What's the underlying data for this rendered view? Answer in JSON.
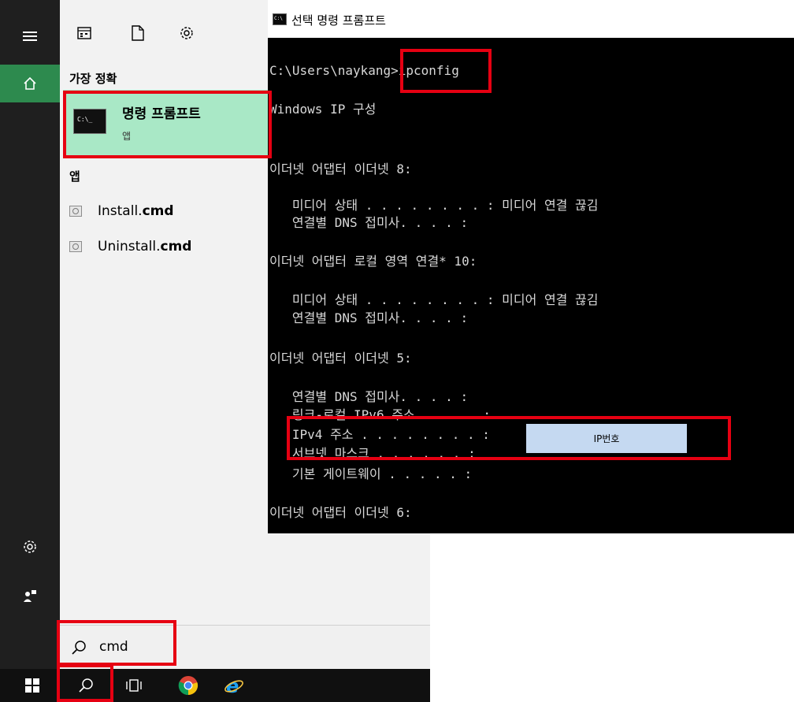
{
  "start_menu": {
    "rail_icons": [
      "hamburger-icon",
      "home-icon",
      "gear-icon",
      "user-feedback-icon"
    ],
    "toolbar_icons": [
      "documents-grid-icon",
      "document-icon",
      "gear-icon"
    ],
    "best_match_header": "가장 정확",
    "best_match": {
      "name": "명령 프롬프트",
      "kind": "앱",
      "icon_text": "C:\\_"
    },
    "apps_header": "앱",
    "apps": [
      {
        "name": "Install.",
        "ext": "cmd"
      },
      {
        "name": "Uninstall.",
        "ext": "cmd"
      }
    ],
    "search": {
      "value": "cmd"
    }
  },
  "taskbar": {
    "icons": [
      "windows-start-icon",
      "search-icon",
      "task-view-icon",
      "chrome-icon",
      "internet-explorer-icon"
    ]
  },
  "cmd_window": {
    "title": "선택 명령 프롬프트",
    "icon_text": "C:\\",
    "lines": {
      "l0": "C:\\Users\\naykang>ipconfig",
      "l1": "Windows IP 구성",
      "l2": "이더넷 어댑터 이더넷 8:",
      "l3": "   미디어 상태 . . . . . . . . : 미디어 연결 끊김",
      "l4": "   연결별 DNS 접미사. . . . :",
      "l5": "이더넷 어댑터 로컬 영역 연결* 10:",
      "l6": "   미디어 상태 . . . . . . . . : 미디어 연결 끊김",
      "l7": "   연결별 DNS 접미사. . . . :",
      "l8": "이더넷 어댑터 이더넷 5:",
      "l9": "   연결별 DNS 접미사. . . . :",
      "l10": "   링크-로컬 IPv6 주소 . . . . :",
      "l11": "   IPv4 주소 . . . . . . . . :",
      "l12": "   서브넷 마스크 . . . . . . :",
      "l13": "   기본 게이트웨이 . . . . . :",
      "l14": "이더넷 어댑터 이더넷 6:"
    },
    "ip_label": "IP번호"
  },
  "colors": {
    "highlight": "#e60012",
    "best_match_bg": "#a9e8c6",
    "home_accent": "#2d8a4e",
    "ip_box": "#c5d9f1"
  }
}
